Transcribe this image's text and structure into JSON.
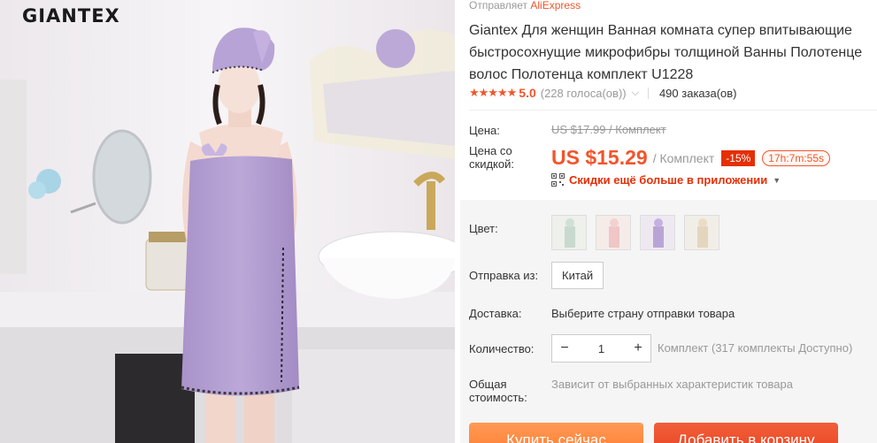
{
  "brand": {
    "logo_text": "GIANTEX"
  },
  "shipper": {
    "prefix": "Отправляет",
    "store": "AliExpress"
  },
  "product": {
    "title_lines": [
      "Giantex Для женщин Ванная комната супер впитывающие",
      "быстросохнущие микрофибры толщиной Ванны Полотенце",
      "волос Полотенца комплект U1228"
    ]
  },
  "rating": {
    "stars": "★★★★★",
    "value": "5.0",
    "votes": "(228 голоса(ов))",
    "orders": "490 заказа(ов)"
  },
  "price": {
    "label": "Цена:",
    "old": "US $17.99 / Комплект",
    "discount_label_line1": "Цена со",
    "discount_label_line2": "скидкой:",
    "current": "US $15.29",
    "unit": "/ Комплект",
    "discount_badge": "-15%",
    "timer": "17h:7m:55s",
    "app_deal": "Скидки ещё больше в приложении"
  },
  "options": {
    "color_label": "Цвет:",
    "ship_from_label": "Отправка из:",
    "ship_from_value": "Китай",
    "delivery_label": "Доставка:",
    "delivery_value": "Выберите страну отправки товара",
    "quantity_label": "Количество:",
    "quantity_value": "1",
    "stock": "Комплект (317 комплекты Доступно)",
    "total_label_line1": "Общая",
    "total_label_line2": "стоимость:",
    "total_value": "Зависит от выбранных характеристик товара"
  },
  "actions": {
    "buy_now": "Купить сейчас",
    "add_to_cart": "Добавить в корзину"
  },
  "colors": {
    "accent": "#f2552c",
    "towel": "#b9a4d6",
    "badge": "#e62e04"
  }
}
